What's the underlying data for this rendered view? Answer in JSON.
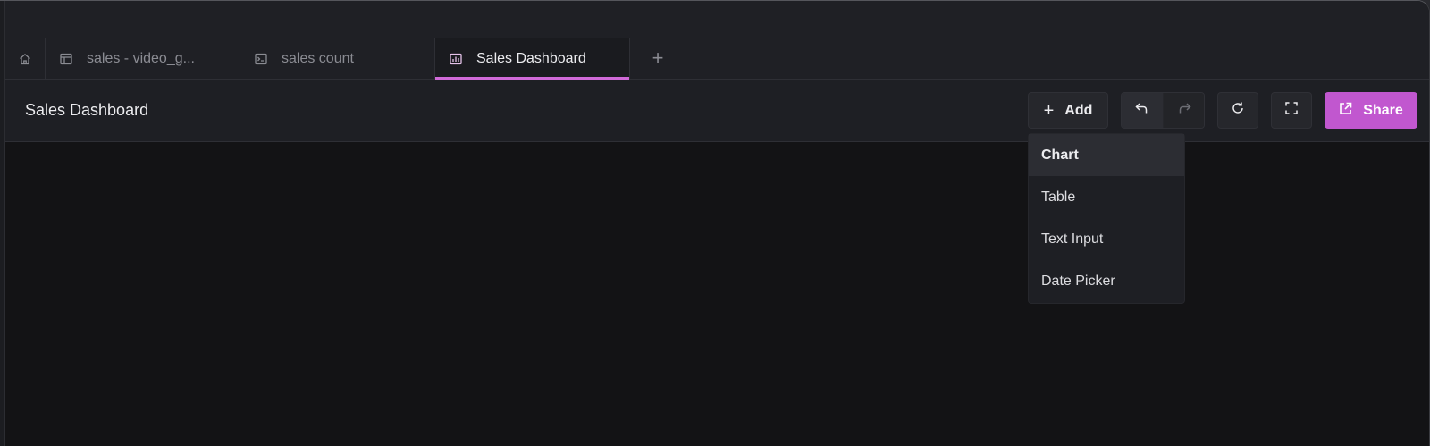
{
  "tabs": [
    {
      "label": "",
      "icon": "home-icon"
    },
    {
      "label": "sales - video_g...",
      "icon": "table-icon"
    },
    {
      "label": "sales count",
      "icon": "terminal-icon"
    },
    {
      "label": "Sales Dashboard",
      "icon": "chart-icon",
      "active": true
    }
  ],
  "tab_add_label": "+",
  "header": {
    "title": "Sales Dashboard",
    "add_label": "Add",
    "share_label": "Share"
  },
  "add_menu": {
    "items": [
      {
        "label": "Chart",
        "highlighted": true
      },
      {
        "label": "Table"
      },
      {
        "label": "Text Input"
      },
      {
        "label": "Date Picker"
      }
    ]
  },
  "colors": {
    "accent": "#c157cf",
    "active_tab_underline": "#d06ad8",
    "background": "#131315",
    "panel": "#1e1f24"
  }
}
